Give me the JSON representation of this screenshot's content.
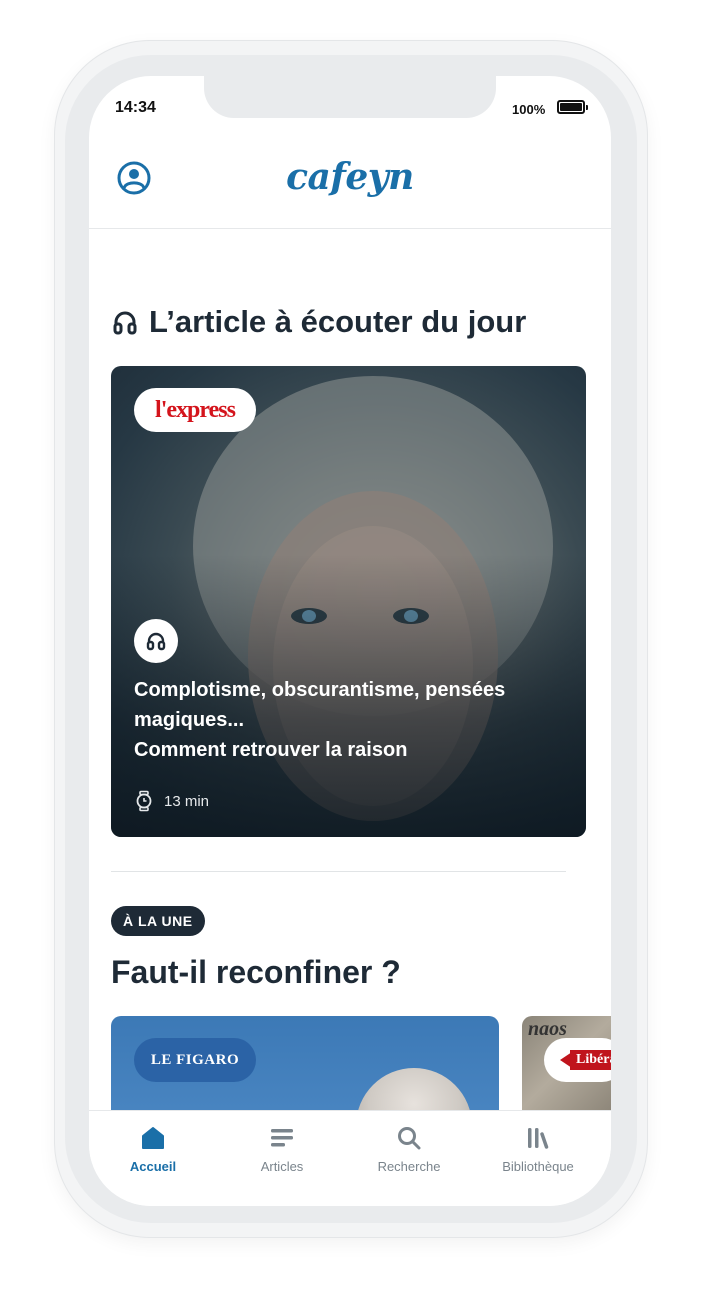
{
  "status_bar": {
    "time": "14:34",
    "battery": "100%"
  },
  "header": {
    "logo": "cafeyn",
    "profile_icon": "user-circle-icon"
  },
  "audio_section": {
    "title": "L’article à écouter du jour",
    "card": {
      "publication": "l'express",
      "title_line1": "Complotisme, obscurantisme, pensées magiques...",
      "title_line2": "Comment retrouver la raison",
      "duration": "13 min"
    }
  },
  "headline_section": {
    "badge": "À LA UNE",
    "title": "Faut-il reconfiner ?",
    "cards": [
      {
        "publication": "LE FIGARO"
      },
      {
        "publication": "Libération",
        "masthead": "naos"
      }
    ]
  },
  "tabbar": {
    "tabs": [
      {
        "label": "Accueil",
        "icon": "home-icon",
        "active": true
      },
      {
        "label": "Articles",
        "icon": "articles-icon",
        "active": false
      },
      {
        "label": "Recherche",
        "icon": "search-icon",
        "active": false
      },
      {
        "label": "Bibliothèque",
        "icon": "library-icon",
        "active": false
      }
    ]
  },
  "colors": {
    "brand": "#1a6fa8",
    "dark": "#1e2a36",
    "express_red": "#d4141c",
    "figaro_blue": "#2b63a6"
  }
}
